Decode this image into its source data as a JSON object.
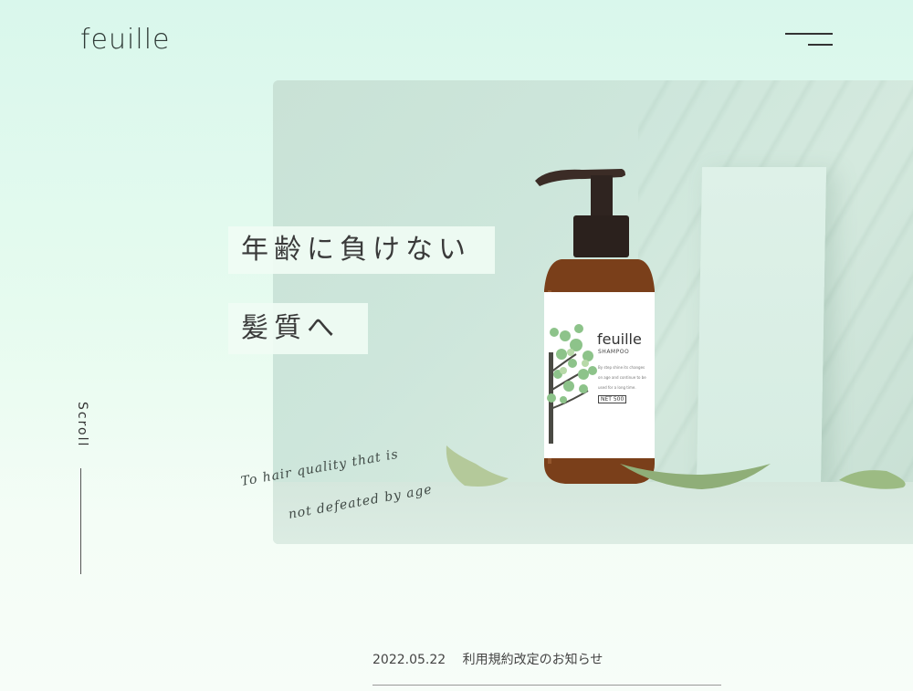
{
  "header": {
    "logo": "feuille",
    "menu_icon": "hamburger-icon"
  },
  "hero": {
    "catch_line1": "年齢に負けない",
    "catch_line2": "髪質へ",
    "script_line1": "To hair quality that is",
    "script_line2": "not defeated by age",
    "product": {
      "brand": "feuille",
      "type": "SHAMPOO",
      "description": "By step shine its changes on age and continue to be used for a long time.",
      "net": "NET 500"
    }
  },
  "side": {
    "scroll_label": "Scroll"
  },
  "news": {
    "date": "2022.05.22",
    "title": "利用規約改定のお知らせ"
  },
  "colors": {
    "background_top": "#d9f7ec",
    "background_bottom": "#f7fdf8",
    "hero_bg": "#cde6db",
    "text": "#333333",
    "bottle": "#7a3f1a",
    "leaf": "#8dc38a"
  }
}
